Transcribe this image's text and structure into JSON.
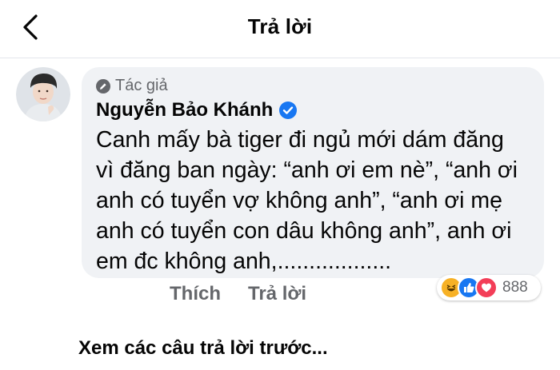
{
  "header": {
    "title": "Trả lời",
    "back_icon": "chevron-left-icon"
  },
  "comment": {
    "role_label": "Tác giả",
    "role_icon": "pencil-icon",
    "author": "Nguyễn Bảo Khánh",
    "verified_icon": "verified-badge-icon",
    "lines": [
      "Canh mấy bà tiger đi ngủ mới dám đăng",
      "vì đăng ban ngày: “anh ơi em nè”, “anh ơi",
      "anh có tuyển vợ không anh”, “anh ơi mẹ",
      "anh có tuyển con dâu không anh”, anh ơi",
      "em đc không anh,.................."
    ],
    "actions": {
      "like": "Thích",
      "reply": "Trả lời"
    },
    "reactions": {
      "icons": [
        "haha-icon",
        "like-icon",
        "love-icon"
      ],
      "count": "888"
    }
  },
  "view_previous": "Xem các câu trả lời trước...",
  "colors": {
    "like": "#1877f2",
    "love": "#f33e58",
    "haha": "#f7b125",
    "bubble": "#f0f2f5",
    "muted": "#65676b"
  }
}
